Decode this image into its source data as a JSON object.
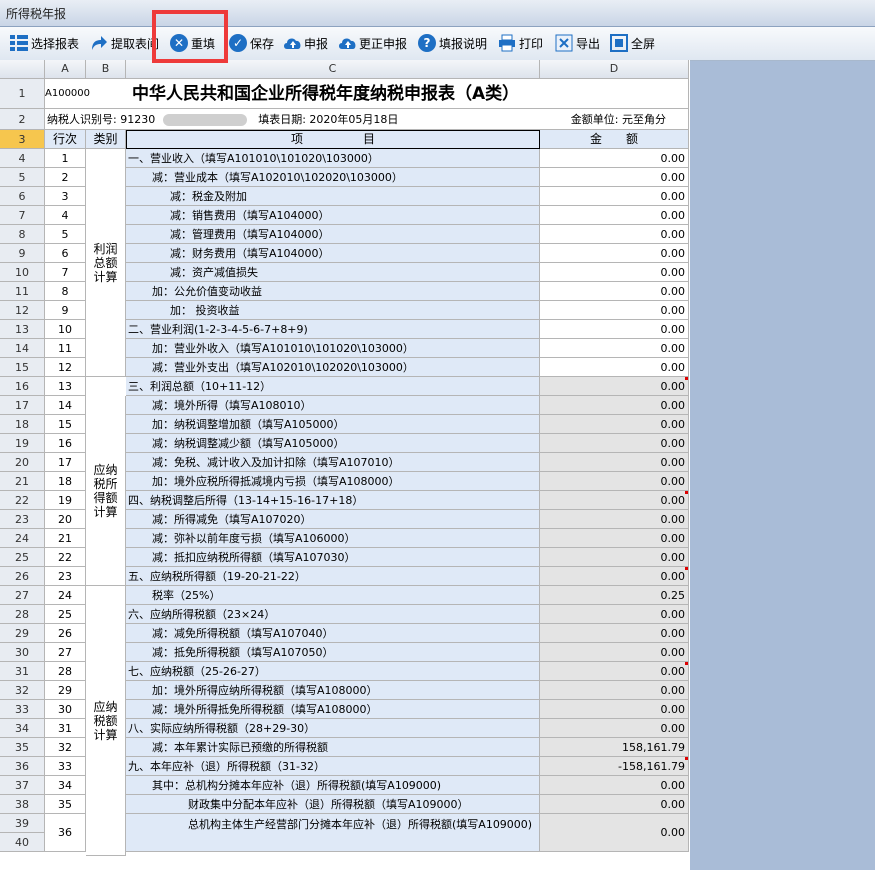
{
  "window": {
    "title": "所得税年报"
  },
  "toolbar": {
    "select": "选择报表",
    "fetch": "提取表间",
    "refill": "重填",
    "save": "保存",
    "declare": "申报",
    "correct": "更正申报",
    "help": "填报说明",
    "print": "打印",
    "export": "导出",
    "fullscreen": "全屏"
  },
  "columns": {
    "A": "A",
    "B": "B",
    "C": "C",
    "D": "D"
  },
  "header": {
    "form_code": "A100000",
    "title": "中华人民共和国企业所得税年度纳税申报表（A类）",
    "taxpayer_id_label": "纳税人识别号: 91230",
    "fill_date": "填表日期: 2020年05月18日",
    "unit": "金额单位: 元至角分"
  },
  "table_header": {
    "seq": "行次",
    "cat": "类别",
    "item": "项　　　　　目",
    "amount": "金　　额"
  },
  "categories": {
    "profit": "利润总额计算",
    "taxable": "应纳税所得额计算",
    "tax": "应纳税额计算"
  },
  "rows": [
    {
      "seq": "1",
      "item": "一、营业收入（填写A101010\\101020\\103000）",
      "amount": "0.00",
      "indent": 0
    },
    {
      "seq": "2",
      "item": "减：营业成本（填写A102010\\102020\\103000）",
      "amount": "0.00",
      "indent": 1
    },
    {
      "seq": "3",
      "item": "减：税金及附加",
      "amount": "0.00",
      "indent": 2
    },
    {
      "seq": "4",
      "item": "减：销售费用（填写A104000）",
      "amount": "0.00",
      "indent": 2
    },
    {
      "seq": "5",
      "item": "减：管理费用（填写A104000）",
      "amount": "0.00",
      "indent": 2
    },
    {
      "seq": "6",
      "item": "减：财务费用（填写A104000）",
      "amount": "0.00",
      "indent": 2
    },
    {
      "seq": "7",
      "item": "减：资产减值损失",
      "amount": "0.00",
      "indent": 2
    },
    {
      "seq": "8",
      "item": "加：公允价值变动收益",
      "amount": "0.00",
      "indent": 1
    },
    {
      "seq": "9",
      "item": "加：  投资收益",
      "amount": "0.00",
      "indent": 2
    },
    {
      "seq": "10",
      "item": "二、营业利润(1-2-3-4-5-6-7+8+9)",
      "amount": "0.00",
      "indent": 0
    },
    {
      "seq": "11",
      "item": "加：营业外收入（填写A101010\\101020\\103000）",
      "amount": "0.00",
      "indent": 1
    },
    {
      "seq": "12",
      "item": "减：营业外支出（填写A102010\\102020\\103000）",
      "amount": "0.00",
      "indent": 1
    },
    {
      "seq": "13",
      "item": "三、利润总额（10+11-12）",
      "amount": "0.00",
      "indent": 0,
      "calc": true,
      "mark": true
    },
    {
      "seq": "14",
      "item": "减：境外所得（填写A108010）",
      "amount": "0.00",
      "indent": 1,
      "calc": true
    },
    {
      "seq": "15",
      "item": "加：纳税调整增加额（填写A105000）",
      "amount": "0.00",
      "indent": 1,
      "calc": true
    },
    {
      "seq": "16",
      "item": "减：纳税调整减少额（填写A105000）",
      "amount": "0.00",
      "indent": 1,
      "calc": true
    },
    {
      "seq": "17",
      "item": "减：免税、减计收入及加计扣除（填写A107010）",
      "amount": "0.00",
      "indent": 1,
      "calc": true
    },
    {
      "seq": "18",
      "item": "加：境外应税所得抵减境内亏损（填写A108000）",
      "amount": "0.00",
      "indent": 1,
      "calc": true
    },
    {
      "seq": "19",
      "item": "四、纳税调整后所得（13-14+15-16-17+18）",
      "amount": "0.00",
      "indent": 0,
      "calc": true,
      "mark": true
    },
    {
      "seq": "20",
      "item": "减：所得减免（填写A107020）",
      "amount": "0.00",
      "indent": 1,
      "calc": true
    },
    {
      "seq": "21",
      "item": "减：弥补以前年度亏损（填写A106000）",
      "amount": "0.00",
      "indent": 1,
      "calc": true
    },
    {
      "seq": "22",
      "item": "减：抵扣应纳税所得额（填写A107030）",
      "amount": "0.00",
      "indent": 1,
      "calc": true
    },
    {
      "seq": "23",
      "item": "五、应纳税所得额（19-20-21-22）",
      "amount": "0.00",
      "indent": 0,
      "calc": true,
      "mark": true
    },
    {
      "seq": "24",
      "item": "税率（25%）",
      "amount": "0.25",
      "indent": 1,
      "calc": true
    },
    {
      "seq": "25",
      "item": "六、应纳所得税额（23×24）",
      "amount": "0.00",
      "indent": 0,
      "calc": true
    },
    {
      "seq": "26",
      "item": "减：减免所得税额（填写A107040）",
      "amount": "0.00",
      "indent": 1,
      "calc": true
    },
    {
      "seq": "27",
      "item": "减：抵免所得税额（填写A107050）",
      "amount": "0.00",
      "indent": 1,
      "calc": true
    },
    {
      "seq": "28",
      "item": "七、应纳税额（25-26-27）",
      "amount": "0.00",
      "indent": 0,
      "calc": true,
      "mark": true
    },
    {
      "seq": "29",
      "item": "加：境外所得应纳所得税额（填写A108000）",
      "amount": "0.00",
      "indent": 1,
      "calc": true
    },
    {
      "seq": "30",
      "item": "减：境外所得抵免所得税额（填写A108000）",
      "amount": "0.00",
      "indent": 1,
      "calc": true
    },
    {
      "seq": "31",
      "item": "八、实际应纳所得税额（28+29-30）",
      "amount": "0.00",
      "indent": 0,
      "calc": true
    },
    {
      "seq": "32",
      "item": "减：本年累计实际已预缴的所得税额",
      "amount": "158,161.79",
      "indent": 1,
      "calc": true
    },
    {
      "seq": "33",
      "item": "九、本年应补（退）所得税额（31-32）",
      "amount": "-158,161.79",
      "indent": 0,
      "calc": true,
      "mark": true
    },
    {
      "seq": "34",
      "item": "其中：总机构分摊本年应补（退）所得税额(填写A109000)",
      "amount": "0.00",
      "indent": 1,
      "calc": true
    },
    {
      "seq": "35",
      "item": "财政集中分配本年应补（退）所得税额（填写A109000）",
      "amount": "0.00",
      "indent": 3,
      "calc": true
    },
    {
      "seq": "36",
      "item": "总机构主体生产经营部门分摊本年应补（退）所得税额(填写A109000)",
      "amount": "0.00",
      "indent": 3,
      "calc": true,
      "tall": true
    }
  ]
}
